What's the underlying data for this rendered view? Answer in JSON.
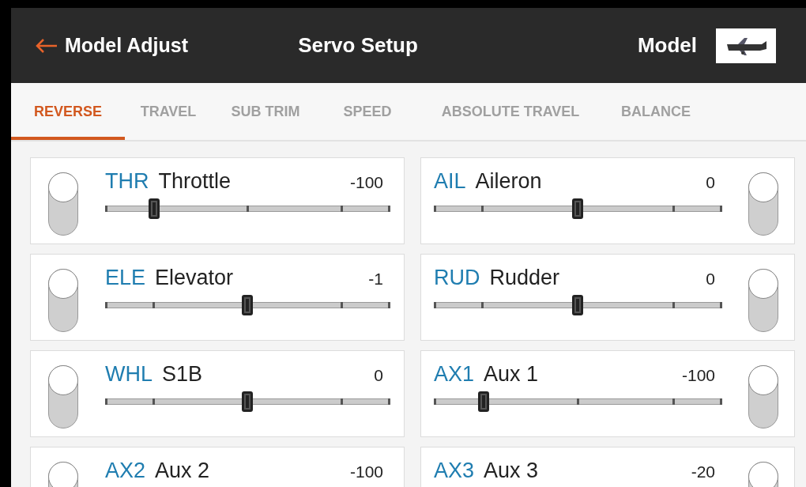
{
  "header": {
    "back_label": "Model Adjust",
    "title": "Servo Setup",
    "model_label": "Model"
  },
  "tabs": [
    {
      "label": "REVERSE",
      "selected": true
    },
    {
      "label": "TRAVEL",
      "selected": false
    },
    {
      "label": "SUB TRIM",
      "selected": false
    },
    {
      "label": "SPEED",
      "selected": false
    },
    {
      "label": "ABSOLUTE TRAVEL",
      "selected": false
    },
    {
      "label": "BALANCE",
      "selected": false
    }
  ],
  "channels": [
    {
      "code": "THR",
      "name": "Throttle",
      "value": "-100",
      "level": 0.17,
      "reversed": false
    },
    {
      "code": "AIL",
      "name": "Aileron",
      "value": "0",
      "level": 0.5,
      "reversed": false
    },
    {
      "code": "ELE",
      "name": "Elevator",
      "value": "-1",
      "level": 0.5,
      "reversed": false
    },
    {
      "code": "RUD",
      "name": "Rudder",
      "value": "0",
      "level": 0.5,
      "reversed": false
    },
    {
      "code": "WHL",
      "name": "S1B",
      "value": "0",
      "level": 0.5,
      "reversed": false
    },
    {
      "code": "AX1",
      "name": "Aux 1",
      "value": "-100",
      "level": 0.17,
      "reversed": false
    },
    {
      "code": "AX2",
      "name": "Aux 2",
      "value": "-100",
      "reversed": false
    },
    {
      "code": "AX3",
      "name": "Aux 3",
      "value": "-20",
      "reversed": false
    }
  ]
}
